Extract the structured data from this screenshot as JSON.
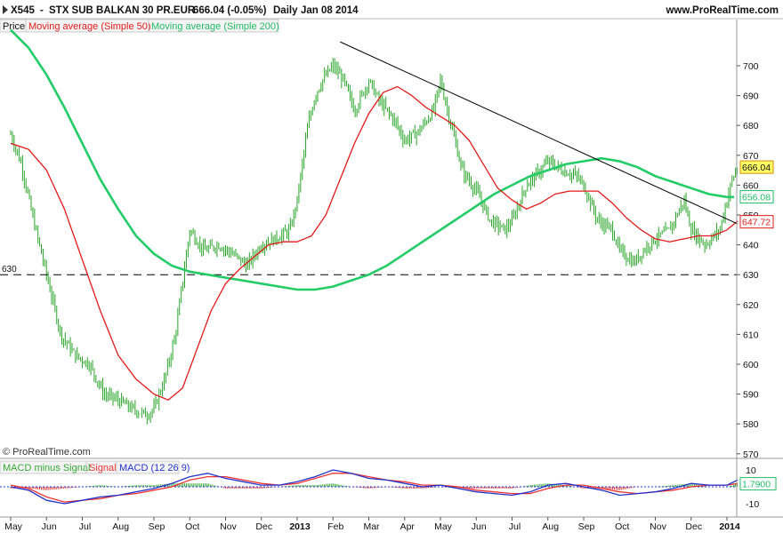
{
  "header": {
    "symbol": "X545",
    "name": "STX SUB BALKAN 30 PR.EUR",
    "last": "666.04 (-0.05%)",
    "period": "Daily",
    "date": "Jan 08 2014",
    "site": "www.ProRealTime.com"
  },
  "legend": {
    "price": "Price",
    "ma50": "Moving average (Simple 50)",
    "ma200": "Moving average (Simple 200)"
  },
  "watermark": "© ProRealTime.com",
  "macd_legend": {
    "hist": "MACD minus Signal",
    "signal": "Signal",
    "macd": "MACD (12 26 9)"
  },
  "colors": {
    "price": "#2aa52a",
    "ma50": "#e31a1a",
    "ma200": "#22cc66",
    "trendline": "#000000",
    "macd": "#2233cc",
    "signal": "#ee3333",
    "support": "#000000"
  },
  "chart_data": [
    {
      "type": "line",
      "title": "X545 - STX SUB BALKAN 30 PR.EUR",
      "ylim": [
        566,
        712
      ],
      "y_ticks": [
        570,
        580,
        590,
        600,
        610,
        620,
        630,
        640,
        650,
        660,
        670,
        680,
        690,
        700
      ],
      "x_tick_labels": [
        "May",
        "Jun",
        "Jul",
        "Aug",
        "Sep",
        "Oct",
        "Nov",
        "Dec",
        "2013",
        "Feb",
        "Mar",
        "Apr",
        "May",
        "Jun",
        "Jul",
        "Aug",
        "Sep",
        "Oct",
        "Nov",
        "Dec",
        "2014"
      ],
      "x_tick_months": [
        0,
        1,
        2,
        3,
        4,
        5,
        6,
        7,
        8,
        9,
        10,
        11,
        12,
        13,
        14,
        15,
        16,
        17,
        18,
        19,
        20
      ],
      "x_unit": "months from May 2012",
      "x_range": [
        0,
        20.3
      ],
      "series": [
        {
          "name": "Price",
          "x": [
            0,
            0.3,
            0.6,
            1.0,
            1.4,
            1.8,
            2.2,
            2.6,
            3.0,
            3.4,
            3.8,
            4.0,
            4.3,
            4.6,
            5.0,
            5.4,
            5.8,
            6.2,
            6.6,
            7.0,
            7.4,
            7.8,
            8.0,
            8.3,
            8.5,
            8.7,
            9.0,
            9.3,
            9.6,
            10.0,
            10.3,
            10.7,
            11.0,
            11.4,
            11.8,
            12.0,
            12.3,
            12.6,
            13.0,
            13.4,
            13.8,
            14.0,
            14.4,
            14.8,
            15.0,
            15.4,
            15.8,
            16.0,
            16.4,
            16.8,
            17.0,
            17.4,
            17.8,
            18.0,
            18.4,
            18.8,
            19.0,
            19.4,
            19.8,
            20.0,
            20.15,
            20.3
          ],
          "values": [
            677,
            667,
            650,
            630,
            610,
            603,
            600,
            590,
            588,
            585,
            583,
            585,
            595,
            610,
            645,
            638,
            640,
            637,
            633,
            640,
            642,
            645,
            655,
            680,
            690,
            695,
            700,
            695,
            685,
            695,
            688,
            682,
            675,
            678,
            685,
            695,
            680,
            665,
            658,
            648,
            645,
            648,
            660,
            665,
            668,
            665,
            663,
            660,
            648,
            645,
            638,
            634,
            640,
            642,
            645,
            655,
            645,
            640,
            645,
            655,
            662,
            666
          ]
        },
        {
          "name": "Moving average (Simple 50)",
          "x": [
            0,
            0.5,
            1.0,
            1.5,
            2.0,
            2.5,
            3.0,
            3.5,
            4.0,
            4.4,
            4.8,
            5.2,
            5.6,
            6.0,
            6.4,
            6.8,
            7.2,
            7.6,
            8.0,
            8.4,
            8.8,
            9.2,
            9.6,
            10.0,
            10.4,
            10.8,
            11.2,
            11.6,
            12.0,
            12.4,
            12.8,
            13.2,
            13.6,
            14.0,
            14.4,
            14.8,
            15.2,
            15.6,
            16.0,
            16.4,
            16.8,
            17.2,
            17.6,
            18.0,
            18.4,
            18.8,
            19.2,
            19.6,
            20.0,
            20.3
          ],
          "values": [
            674,
            672,
            665,
            652,
            635,
            618,
            603,
            595,
            590,
            588,
            592,
            605,
            618,
            627,
            632,
            636,
            640,
            641,
            641,
            643,
            650,
            662,
            674,
            684,
            691,
            693,
            690,
            686,
            683,
            680,
            675,
            667,
            659,
            655,
            652,
            654,
            657,
            658,
            658,
            658,
            654,
            649,
            645,
            642,
            641,
            642,
            643,
            643,
            645,
            648
          ]
        },
        {
          "name": "Moving average (Simple 200)",
          "x": [
            0,
            0.5,
            1.0,
            1.5,
            2.0,
            2.5,
            3.0,
            3.5,
            4.0,
            4.5,
            5.0,
            5.5,
            6.0,
            6.5,
            7.0,
            7.5,
            8.0,
            8.5,
            9.0,
            9.5,
            10.0,
            10.5,
            11.0,
            11.5,
            12.0,
            12.5,
            13.0,
            13.5,
            14.0,
            14.5,
            15.0,
            15.5,
            16.0,
            16.5,
            17.0,
            17.5,
            18.0,
            18.5,
            19.0,
            19.5,
            20.0,
            20.2
          ],
          "values": [
            712,
            706,
            697,
            686,
            674,
            662,
            652,
            643,
            637,
            633,
            631,
            630,
            629,
            628,
            627,
            626,
            625,
            625,
            626,
            628,
            630,
            633,
            637,
            641,
            645,
            649,
            653,
            657,
            660,
            663,
            665,
            667,
            668,
            669,
            668,
            666,
            663,
            661,
            659,
            657,
            656,
            656
          ]
        }
      ],
      "annotations": [
        {
          "label": "630",
          "value": 630
        },
        {
          "label": "666.04",
          "value": 666.04
        },
        {
          "label": "656.08",
          "value": 656.08
        },
        {
          "label": "647.72",
          "value": 647.72
        }
      ],
      "trendline": {
        "x": [
          9.2,
          20.3
        ],
        "values": [
          708,
          647
        ]
      },
      "grid": false
    },
    {
      "type": "bar",
      "title": "MACD (12 26 9)",
      "ylim": [
        -13,
        14
      ],
      "y_ticks": [
        10,
        -10
      ],
      "annotations": [
        {
          "label": "1.7900",
          "value": 1.79
        }
      ],
      "x": [
        0,
        0.5,
        1.0,
        1.5,
        2.0,
        2.5,
        3.0,
        3.5,
        4.0,
        4.5,
        5.0,
        5.5,
        6.0,
        6.5,
        7.0,
        7.5,
        8.0,
        8.5,
        9.0,
        9.5,
        10.0,
        10.5,
        11.0,
        11.5,
        12.0,
        12.5,
        13.0,
        13.5,
        14.0,
        14.5,
        15.0,
        15.5,
        16.0,
        16.5,
        17.0,
        17.5,
        18.0,
        18.5,
        19.0,
        19.5,
        20.0,
        20.3
      ],
      "series": [
        {
          "name": "MACD (12 26 9)",
          "values": [
            0,
            -2,
            -8,
            -10,
            -8,
            -6,
            -5,
            -3,
            -1,
            2,
            6,
            8,
            5,
            3,
            1,
            1,
            3,
            6,
            10,
            8,
            5,
            4,
            2,
            0,
            1,
            -1,
            -3,
            -4,
            -5,
            -3,
            1,
            2,
            0,
            -2,
            -5,
            -4,
            -3,
            -1,
            2,
            1,
            1,
            4
          ]
        },
        {
          "name": "Signal",
          "values": [
            1,
            -1,
            -6,
            -9,
            -8,
            -7,
            -5,
            -4,
            -2,
            0,
            4,
            6,
            6,
            4,
            2,
            1,
            2,
            5,
            8,
            8,
            6,
            4,
            3,
            1,
            1,
            0,
            -2,
            -3,
            -4,
            -4,
            -1,
            1,
            1,
            -1,
            -3,
            -4,
            -3,
            -2,
            0,
            1,
            1,
            2
          ]
        },
        {
          "name": "MACD minus Signal",
          "values": [
            -1,
            -1,
            -2,
            -1,
            0,
            1,
            0,
            1,
            1,
            2,
            2,
            2,
            -1,
            -1,
            -1,
            0,
            1,
            1,
            2,
            0,
            -1,
            0,
            -1,
            -1,
            0,
            -1,
            -1,
            -1,
            -1,
            1,
            2,
            1,
            -1,
            -1,
            -2,
            0,
            0,
            1,
            2,
            0,
            0,
            2
          ]
        }
      ]
    }
  ]
}
